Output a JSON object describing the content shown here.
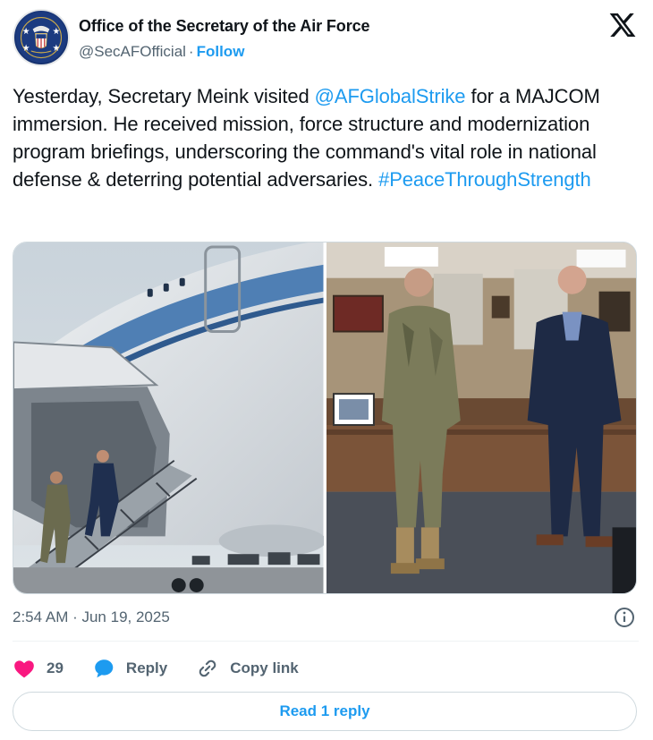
{
  "author": {
    "name": "Office of the Secretary of the Air Force",
    "handle": "@SecAFOfficial",
    "separator": "·",
    "follow_label": "Follow",
    "avatar_icon": "air-force-seal-icon"
  },
  "post": {
    "text_before": "Yesterday, Secretary Meink visited ",
    "mention": "@AFGlobalStrike",
    "text_middle": " for a MAJCOM immersion. He received mission, force structure and modernization program briefings, underscoring the command's vital role in national defense & deterring potential adversaries. ",
    "hashtag": "#PeaceThroughStrength"
  },
  "media": {
    "photos": [
      {
        "icon": "aircraft-boarding-photo"
      },
      {
        "icon": "office-meeting-photo"
      }
    ]
  },
  "meta": {
    "timestamp": "2:54 AM · Jun 19, 2025"
  },
  "actions": {
    "likes_count": "29",
    "reply_label": "Reply",
    "copy_link_label": "Copy link"
  },
  "footer": {
    "read_replies_label": "Read 1 reply"
  },
  "colors": {
    "accent": "#1d9bf0",
    "like": "#f91880",
    "text": "#0f1419",
    "muted": "#536471"
  }
}
